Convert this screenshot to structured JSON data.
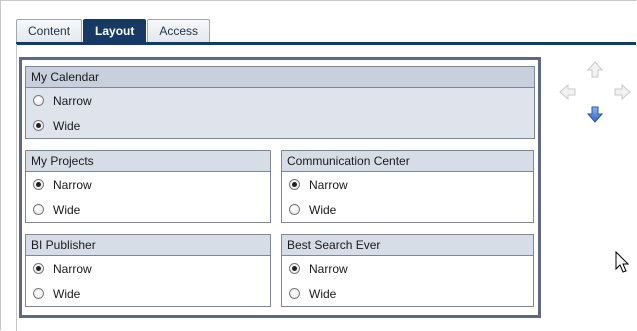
{
  "tabs": [
    {
      "label": "Content",
      "active": false
    },
    {
      "label": "Layout",
      "active": true
    },
    {
      "label": "Access",
      "active": false
    }
  ],
  "portlets": {
    "calendar": {
      "title": "My Calendar",
      "options": [
        {
          "label": "Narrow",
          "checked": false
        },
        {
          "label": "Wide",
          "checked": true
        }
      ]
    },
    "projects": {
      "title": "My Projects",
      "options": [
        {
          "label": "Narrow",
          "checked": true
        },
        {
          "label": "Wide",
          "checked": false
        }
      ]
    },
    "communication": {
      "title": "Communication Center",
      "options": [
        {
          "label": "Narrow",
          "checked": true
        },
        {
          "label": "Wide",
          "checked": false
        }
      ]
    },
    "bi": {
      "title": "BI Publisher",
      "options": [
        {
          "label": "Narrow",
          "checked": true
        },
        {
          "label": "Wide",
          "checked": false
        }
      ]
    },
    "search": {
      "title": "Best Search Ever",
      "options": [
        {
          "label": "Narrow",
          "checked": true
        },
        {
          "label": "Wide",
          "checked": false
        }
      ]
    }
  },
  "arrows": {
    "up": {
      "icon": "arrow-up-icon",
      "state": "disabled"
    },
    "left": {
      "icon": "arrow-left-icon",
      "state": "disabled"
    },
    "right": {
      "icon": "arrow-right-icon",
      "state": "disabled"
    },
    "down": {
      "icon": "arrow-down-icon",
      "state": "active"
    }
  },
  "colors": {
    "tab_active": "#163a63",
    "portlet_header": "#d7dde6",
    "selected_portlet": "#dfe4ec",
    "arrow_active": "#3c78d8",
    "arrow_disabled": "#c8c8c8"
  }
}
